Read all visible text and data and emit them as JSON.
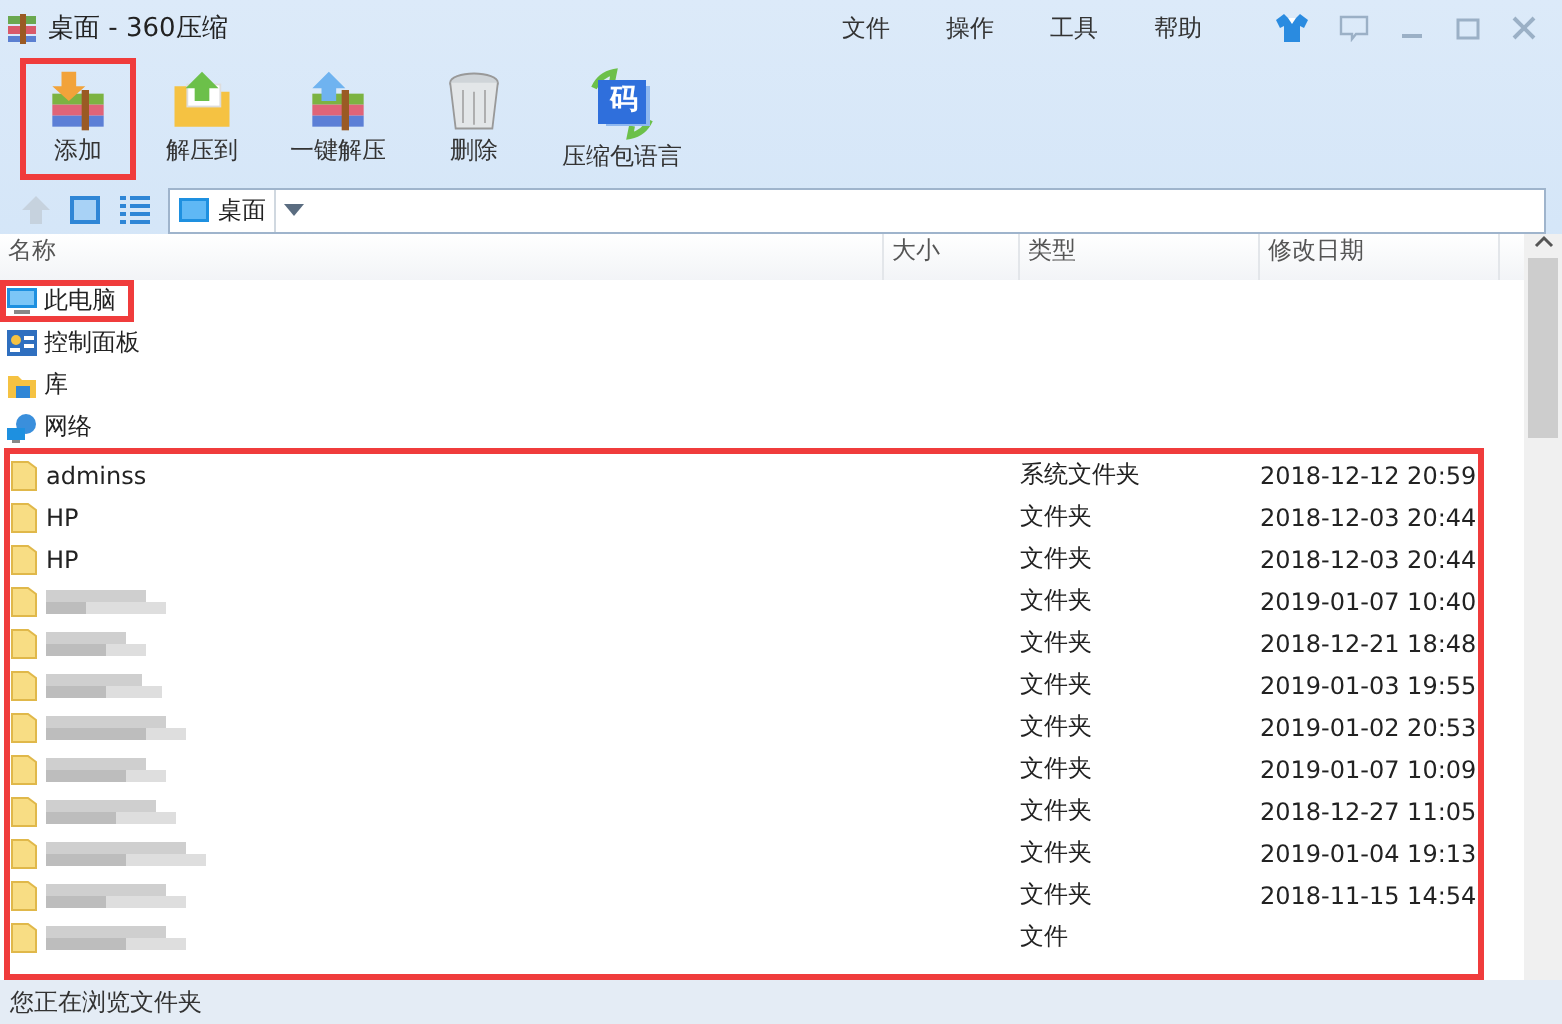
{
  "window": {
    "title": "桌面 - 360压缩"
  },
  "menu": [
    "文件",
    "操作",
    "工具",
    "帮助"
  ],
  "toolbar": [
    {
      "label": "添加",
      "kind": "add",
      "highlighted": true
    },
    {
      "label": "解压到",
      "kind": "extract",
      "highlighted": false
    },
    {
      "label": "一键解压",
      "kind": "oneclick",
      "highlighted": false
    },
    {
      "label": "删除",
      "kind": "delete",
      "highlighted": false
    },
    {
      "label": "压缩包语言",
      "kind": "language",
      "icon_text": "码",
      "highlighted": false
    }
  ],
  "address": {
    "value": "桌面"
  },
  "columns": [
    "名称",
    "大小",
    "类型",
    "修改日期"
  ],
  "places": [
    {
      "name": "此电脑",
      "kind": "computer",
      "highlighted": true
    },
    {
      "name": "控制面板",
      "kind": "control",
      "highlighted": false
    },
    {
      "name": "库",
      "kind": "library",
      "highlighted": false
    },
    {
      "name": "网络",
      "kind": "network",
      "highlighted": false
    }
  ],
  "files": {
    "highlighted": true,
    "rows": [
      {
        "name": "adminss",
        "blurred": false,
        "type": "系统文件夹",
        "modified": "2018-12-12 20:59"
      },
      {
        "name": "HP",
        "blurred": false,
        "type": "文件夹",
        "modified": "2018-12-03 20:44"
      },
      {
        "name": "HP",
        "blurred": false,
        "type": "文件夹",
        "modified": "2018-12-03 20:44"
      },
      {
        "blurred": true,
        "type": "文件夹",
        "modified": "2019-01-07 10:40"
      },
      {
        "blurred": true,
        "type": "文件夹",
        "modified": "2018-12-21 18:48"
      },
      {
        "blurred": true,
        "type": "文件夹",
        "modified": "2019-01-03 19:55"
      },
      {
        "blurred": true,
        "type": "文件夹",
        "modified": "2019-01-02 20:53"
      },
      {
        "blurred": true,
        "type": "文件夹",
        "modified": "2019-01-07 10:09"
      },
      {
        "blurred": true,
        "type": "文件夹",
        "modified": "2018-12-27 11:05"
      },
      {
        "blurred": true,
        "type": "文件夹",
        "modified": "2019-01-04 19:13"
      },
      {
        "blurred": true,
        "type": "文件夹",
        "modified": "2018-11-15 14:54"
      },
      {
        "blurred": true,
        "type": "文件"
      }
    ]
  },
  "status_bar": "您正在浏览文件夹"
}
